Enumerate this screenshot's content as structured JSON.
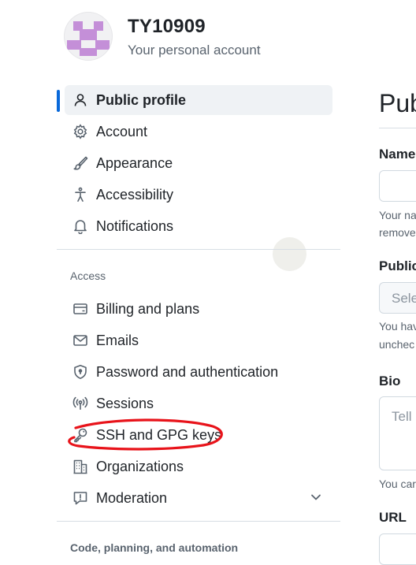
{
  "account": {
    "name": "TY10909",
    "subtitle": "Your personal account",
    "avatar_color": "#c48fd8"
  },
  "nav": {
    "primary": [
      {
        "label": "Public profile",
        "icon": "person-icon",
        "active": true
      },
      {
        "label": "Account",
        "icon": "gear-icon"
      },
      {
        "label": "Appearance",
        "icon": "paintbrush-icon"
      },
      {
        "label": "Accessibility",
        "icon": "accessibility-icon"
      },
      {
        "label": "Notifications",
        "icon": "bell-icon"
      }
    ],
    "access_heading": "Access",
    "access": [
      {
        "label": "Billing and plans",
        "icon": "credit-card-icon"
      },
      {
        "label": "Emails",
        "icon": "mail-icon"
      },
      {
        "label": "Password and authentication",
        "icon": "shield-lock-icon"
      },
      {
        "label": "Sessions",
        "icon": "broadcast-icon"
      },
      {
        "label": "SSH and GPG keys",
        "icon": "key-icon",
        "annotated": true
      },
      {
        "label": "Organizations",
        "icon": "organization-icon"
      },
      {
        "label": "Moderation",
        "icon": "report-icon",
        "expandable": true
      }
    ],
    "code_heading": "Code, planning, and automation"
  },
  "main": {
    "title": "Publ",
    "name_label": "Name",
    "name_help": [
      "Your na",
      "remove"
    ],
    "email_label": "Public",
    "email_select": "Sele",
    "email_help": [
      "You hav",
      "unchec"
    ],
    "bio_label": "Bio",
    "bio_placeholder": "Tell",
    "bio_help": "You car",
    "url_label": "URL"
  },
  "colors": {
    "accent": "#0969da",
    "annotation": "#e8131a",
    "active_bg": "#eff2f5"
  }
}
